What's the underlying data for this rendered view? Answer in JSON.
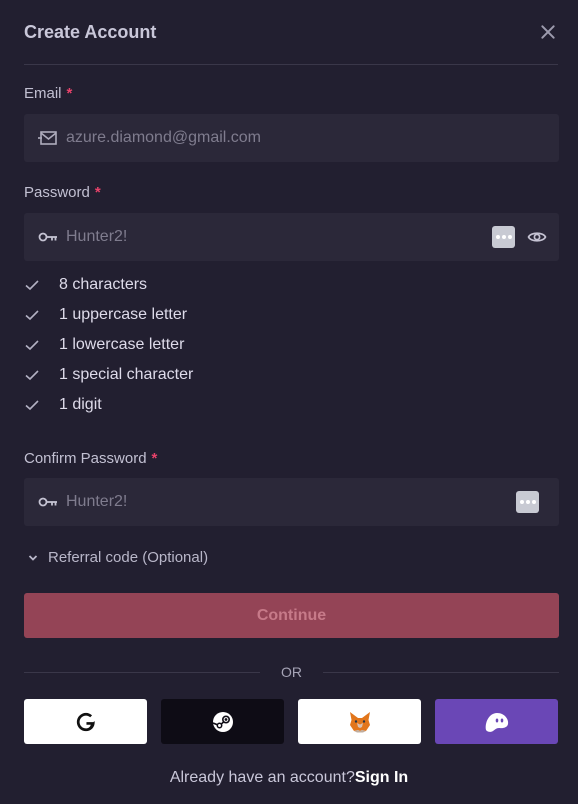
{
  "modal": {
    "title": "Create Account",
    "close_icon": "close-icon"
  },
  "email": {
    "label": "Email",
    "required_mark": "*",
    "placeholder": "azure.diamond@gmail.com",
    "icon": "mail-icon"
  },
  "password": {
    "label": "Password",
    "required_mark": "*",
    "placeholder": "Hunter2!",
    "icon": "key-icon"
  },
  "rules": [
    {
      "label": "8 characters"
    },
    {
      "label": "1 uppercase letter"
    },
    {
      "label": "1 lowercase letter"
    },
    {
      "label": "1 special character"
    },
    {
      "label": "1 digit"
    }
  ],
  "confirm_password": {
    "label": "Confirm Password",
    "required_mark": "*",
    "placeholder": "Hunter2!",
    "icon": "key-icon"
  },
  "referral": {
    "label": "Referral code (Optional)"
  },
  "continue_button": "Continue",
  "divider_text": "OR",
  "social": [
    {
      "name": "google",
      "icon": "google-icon"
    },
    {
      "name": "steam",
      "icon": "steam-icon"
    },
    {
      "name": "metamask",
      "icon": "metamask-fox-icon"
    },
    {
      "name": "phantom",
      "icon": "ghost-icon"
    }
  ],
  "footer": {
    "prompt": "Already have an account?",
    "link": "Sign In"
  },
  "colors": {
    "background": "#221f30",
    "field": "#2b2839",
    "accent_required": "#e8426a",
    "continue_bg": "#944456",
    "phantom_bg": "#6a47b6"
  }
}
